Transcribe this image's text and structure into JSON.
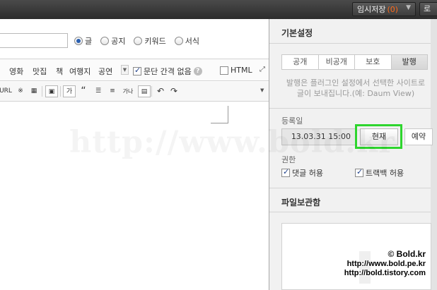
{
  "topbar": {
    "draft_label": "임시저장",
    "draft_count_text": "(0)",
    "cut_button": "로"
  },
  "editor": {
    "post_types": [
      {
        "label": "글",
        "selected": true
      },
      {
        "label": "공지",
        "selected": false
      },
      {
        "label": "키워드",
        "selected": false
      },
      {
        "label": "서식",
        "selected": false
      }
    ],
    "categories": [
      "영화",
      "맛집",
      "책",
      "여행지",
      "공연"
    ],
    "paragraph_gap_label": "문단 간격 없음",
    "help_glyph": "?",
    "html_label": "HTML",
    "toolbar_labels": {
      "url": "URL",
      "style": "가",
      "quote": "“",
      "spell": "가나"
    }
  },
  "panel": {
    "basic_title": "기본설정",
    "tabs": [
      "공개",
      "비공개",
      "보호",
      "발행"
    ],
    "active_tab": "발행",
    "hint_line1": "발행은 플러그인 설정에서 선택한 사이트로",
    "hint_line2": "글이 보내집니다.(예: Daum View)",
    "date_label": "등록일",
    "date_value": "13.03.31 15:00",
    "now_button": "현재",
    "reserve_button": "예약",
    "permission_label": "권한",
    "comment_label": "댓글 허용",
    "trackback_label": "트랙백 허용",
    "file_title": "파일보관함"
  },
  "watermark": "http://www.bold.kr",
  "credits": {
    "line1": "© Bold.kr",
    "line2": "http://www.bold.pe.kr",
    "line3": "http://bold.tistory.com"
  }
}
